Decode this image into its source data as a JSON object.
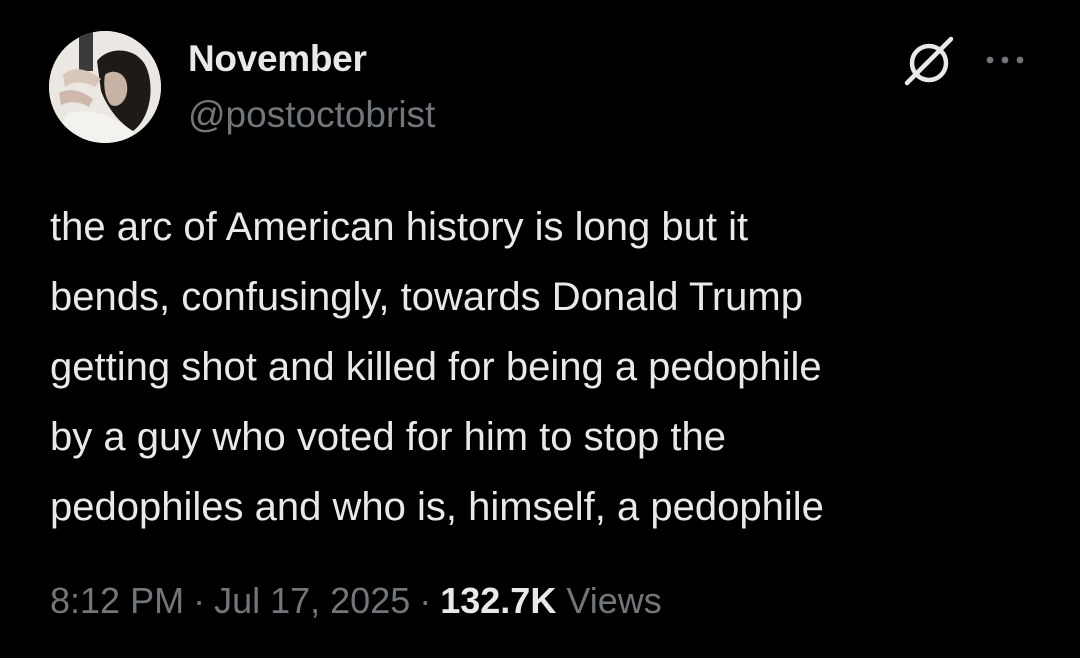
{
  "author": {
    "display_name": "November",
    "handle": "@postoctobrist"
  },
  "post": {
    "text_lines": [
      "the arc of American history is long but it",
      "bends, confusingly, towards Donald Trump",
      "getting shot and killed for being a pedophile",
      "by a guy who voted for him to stop the",
      "pedophiles and who is, himself, a pedophile"
    ]
  },
  "meta": {
    "time": "8:12 PM",
    "separator": "·",
    "date": "Jul 17, 2025",
    "views_count": "132.7K",
    "views_label": "Views"
  },
  "icons": {
    "grok": "grok-icon",
    "more": "more-options-icon"
  },
  "colors": {
    "background": "#000000",
    "primary_text": "#e7e9ea",
    "secondary_text": "#71767b"
  }
}
